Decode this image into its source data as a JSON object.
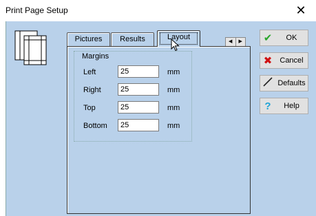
{
  "window": {
    "title": "Print Page Setup",
    "close_glyph": "✕"
  },
  "tabs": [
    {
      "label": "Pictures"
    },
    {
      "label": "Results"
    },
    {
      "label": "Layout"
    }
  ],
  "tab_scroll": {
    "left": "◀",
    "right": "▶"
  },
  "margins": {
    "title": "Margins",
    "fields": [
      {
        "label": "Left",
        "value": "25",
        "unit": "mm"
      },
      {
        "label": "Right",
        "value": "25",
        "unit": "mm"
      },
      {
        "label": "Top",
        "value": "25",
        "unit": "mm"
      },
      {
        "label": "Bottom",
        "value": "25",
        "unit": "mm"
      }
    ]
  },
  "buttons": {
    "ok": {
      "label": "OK",
      "icon": "checkmark-icon",
      "color": "#2aa62a"
    },
    "cancel": {
      "label": "Cancel",
      "icon": "x-icon",
      "color": "#d01010"
    },
    "defaults": {
      "label": "Defaults",
      "icon": "pen-icon",
      "color": "#222222"
    },
    "help": {
      "label": "Help",
      "icon": "question-mark-icon",
      "color": "#1fa3d6"
    }
  },
  "colors": {
    "client_bg": "#b9d1ea"
  }
}
